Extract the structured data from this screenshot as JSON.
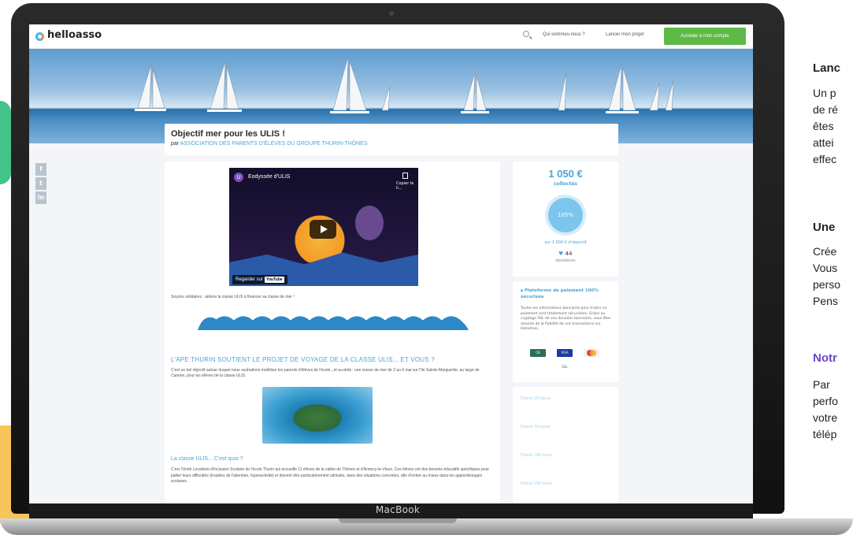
{
  "site": {
    "logo_text": "helloasso",
    "nav": {
      "who": "Qui sommes-nous ?",
      "launch": "Lancer mon projet",
      "account_button": "Accéder à mon compte"
    }
  },
  "campaign": {
    "title": "Objectif mer pour les ULIS !",
    "by_prefix": "par",
    "organization": "ASSOCIATION DES PARENTS D'ÉLÈVES DU GROUPE THURIN-THÔNES",
    "video": {
      "avatar_letter": "U",
      "title": "Eodyssée d'ULIS",
      "copy_label": "Copier le li...",
      "watch_on": "Regarder sur",
      "youtube": "YouTube"
    },
    "intro": "Soyons solidaires : aidons la classe ULIS à financer sa classe de mer !",
    "section_heading": "L'APE THURIN SOUTIENT LE PROJET DE VOYAGE DE LA CLASSE ULIS... ET VOUS ?",
    "section_text": "C'est un bel objectif autour duquel nous souhaitons mobiliser les parents d'élèves de l'école...et au-delà : une classe de mer de 2 au 6 mai sur l'île Sainte-Marguerite, au large de Cannes, pour les élèves de la classe ULIS.",
    "subheading": "La classe ULIS... C'est quoi ?",
    "sub_text": "C'est l'Unité Localisée d'Inclusion Scolaire de l'école Thurin qui accueille 11 élèves de la vallée de Thônes et d'Annecy-le-Vieux. Ces élèves ont des besoins éducatifs spécifiques pour pallier leurs difficultés (troubles de l'attention, hyperactivité) et doivent être particulièrement stimulés, dans des situations concrètes, afin d'entrer au mieux dans les apprentissages scolaires."
  },
  "progress": {
    "amount": "1 050 €",
    "collected_label": "collectés",
    "percent": "105%",
    "goal": "sur 1 000 € d'objectif",
    "donors_count": "44",
    "donors_label": "donateurs"
  },
  "security": {
    "title": "Plateforme de paiement 100% sécurisée",
    "body": "Toutes les informations bancaires pour traiter ce paiement sont totalement sécurisées. Grâce au cryptage SSL de vos données bancaires, vous êtes assurés de la fiabilité de vos transactions sur HelloAsso."
  },
  "donate_options": [
    "Donner 20 euros",
    "Donner 50 euros",
    "Donner 100 euros",
    "Donner 200 euros"
  ],
  "device_label": "MacBook",
  "right_panel": {
    "heading1": "Lanc",
    "p1": [
      "Un p",
      "de ré",
      "êtes",
      "attei",
      "effec"
    ],
    "heading2": "Une",
    "p2": [
      "Crée",
      "Vous",
      "perso",
      "Pens"
    ],
    "heading3": "Notr",
    "p3": [
      "Par",
      "perfo",
      "votre",
      "télép"
    ]
  },
  "colors": {
    "brand_blue": "#49a6d8",
    "brand_green": "#5fb946",
    "accent_purple": "#6c47c9",
    "blob_green": "#43c38a",
    "blob_yellow": "#f8c55a"
  }
}
